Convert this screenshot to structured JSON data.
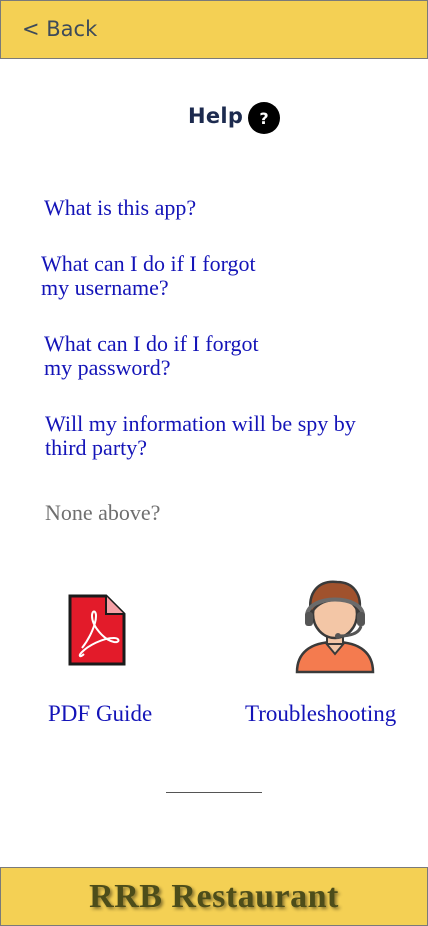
{
  "header": {
    "back_label": "< Back"
  },
  "help": {
    "title": "Help",
    "icon_glyph": "?"
  },
  "faq": [
    {
      "line1": "What is this app?",
      "line2": ""
    },
    {
      "line1": "What can I do if  I forgot",
      "line2": "my username?"
    },
    {
      "line1": "What can I do if  I forgot",
      "line2": "my password?"
    },
    {
      "line1": "Will my information will be spy by",
      "line2": "third party?"
    }
  ],
  "none_above": "None above?",
  "resources": {
    "pdf_label": "PDF Guide",
    "troubleshooting_label": "Troubleshooting"
  },
  "footer": {
    "title": "RRB Restaurant"
  },
  "colors": {
    "bar_bg": "#f4d054",
    "link": "#1414b8",
    "muted": "#6f6f6f",
    "footer_text": "#4d4d1a"
  }
}
